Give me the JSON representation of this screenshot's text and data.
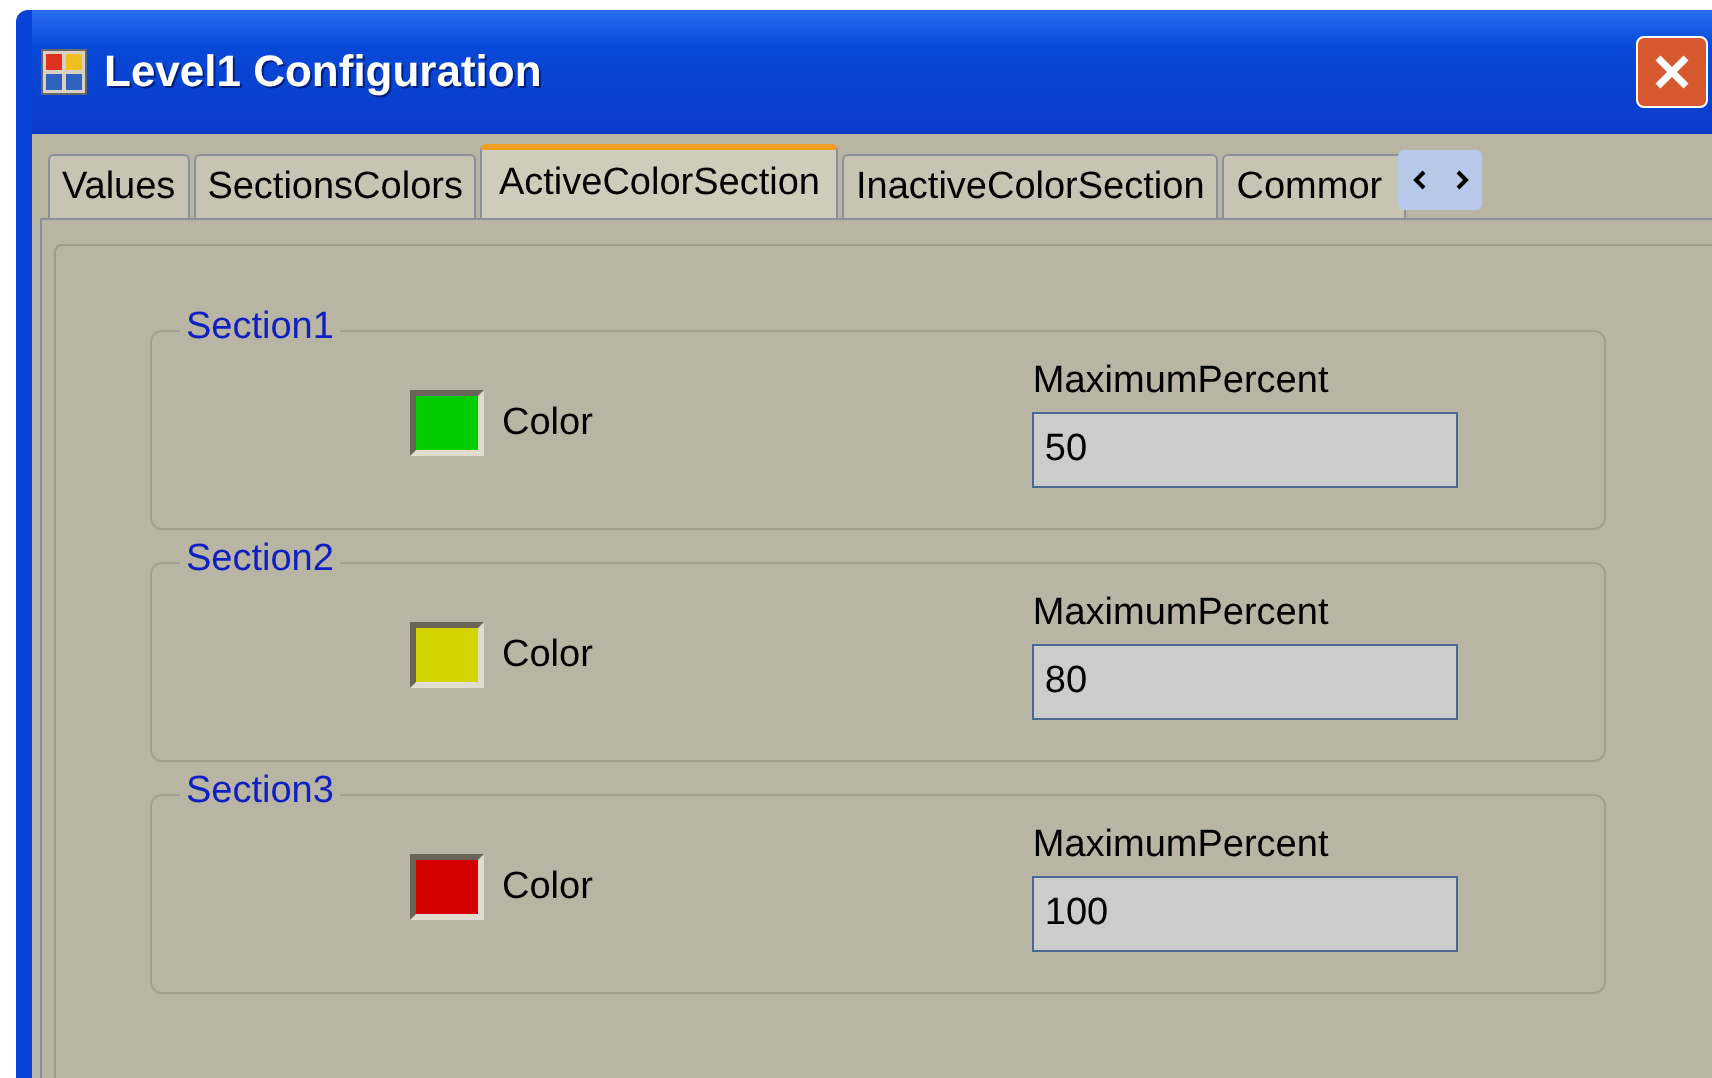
{
  "window": {
    "title": "Level1 Configuration"
  },
  "tabs": [
    {
      "label": "Values",
      "selected": false
    },
    {
      "label": "SectionsColors",
      "selected": false
    },
    {
      "label": "ActiveColorSection",
      "selected": true
    },
    {
      "label": "InactiveColorSection",
      "selected": false
    },
    {
      "label": "Commor",
      "selected": false
    }
  ],
  "sections": [
    {
      "title": "Section1",
      "color_label": "Color",
      "color": "#00cc00",
      "field_label": "MaximumPercent",
      "value": "50"
    },
    {
      "title": "Section2",
      "color_label": "Color",
      "color": "#d4d400",
      "field_label": "MaximumPercent",
      "value": "80"
    },
    {
      "title": "Section3",
      "color_label": "Color",
      "color": "#d40000",
      "field_label": "MaximumPercent",
      "value": "100"
    }
  ]
}
